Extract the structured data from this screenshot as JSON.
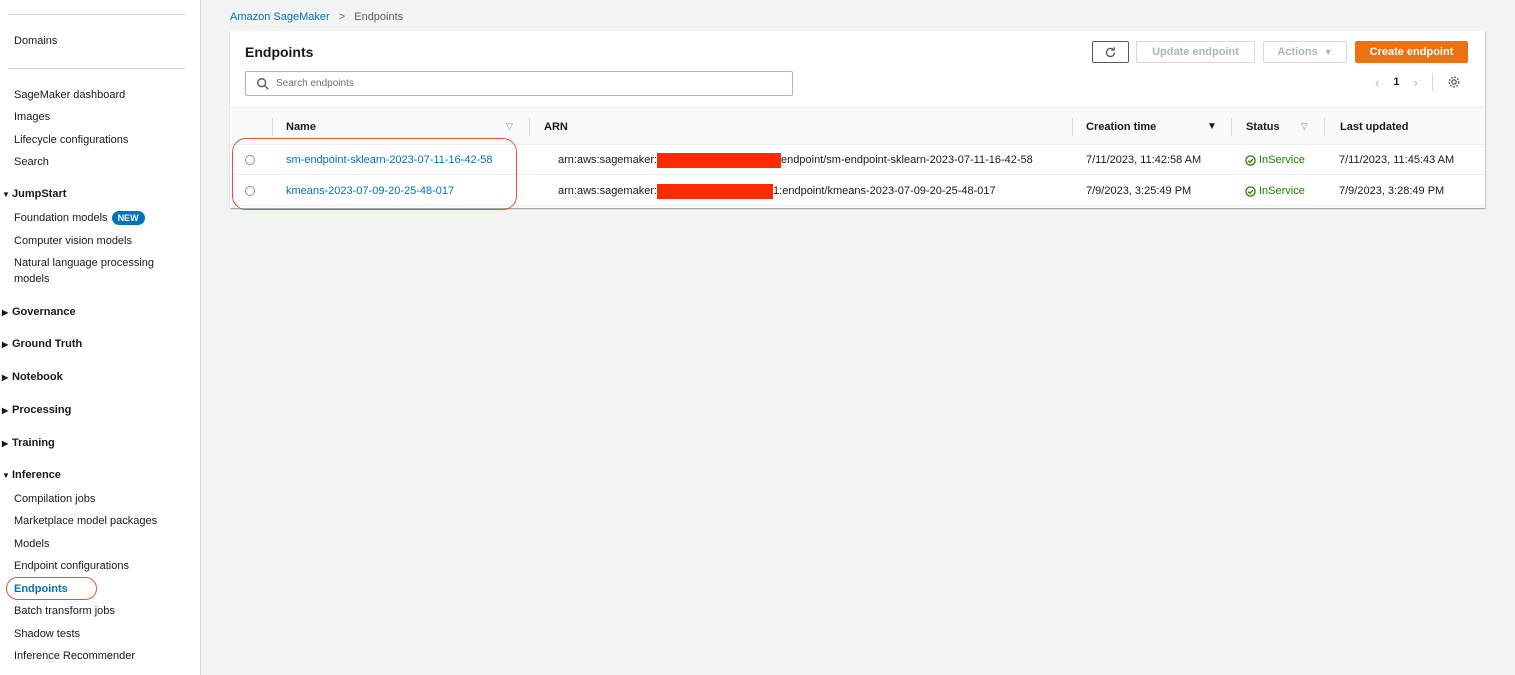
{
  "sidebar": {
    "top_items": [
      "Domains"
    ],
    "dashboard_items": [
      "SageMaker dashboard",
      "Images",
      "Lifecycle configurations",
      "Search"
    ],
    "jumpstart": {
      "title": "JumpStart",
      "items": [
        "Foundation models",
        "Computer vision models",
        "Natural language processing models"
      ],
      "new_badge": "NEW"
    },
    "collapsed_sections": [
      "Governance",
      "Ground Truth",
      "Notebook",
      "Processing",
      "Training"
    ],
    "inference": {
      "title": "Inference",
      "items": [
        "Compilation jobs",
        "Marketplace model packages",
        "Models",
        "Endpoint configurations",
        "Endpoints",
        "Batch transform jobs",
        "Shadow tests",
        "Inference Recommender"
      ],
      "active_item": "Endpoints"
    }
  },
  "breadcrumb": {
    "parent": "Amazon SageMaker",
    "current": "Endpoints"
  },
  "panel": {
    "title": "Endpoints",
    "buttons": {
      "update": "Update endpoint",
      "actions": "Actions",
      "create": "Create endpoint"
    },
    "search_placeholder": "Search endpoints",
    "page": "1"
  },
  "table": {
    "columns": [
      "Name",
      "ARN",
      "Creation time",
      "Status",
      "Last updated"
    ],
    "rows": [
      {
        "name": "sm-endpoint-sklearn-2023-07-11-16-42-58",
        "arn_prefix": "arn:aws:sagemaker:",
        "arn_suffix": "endpoint/sm-endpoint-sklearn-2023-07-11-16-42-58",
        "creation_time": "7/11/2023, 11:42:58 AM",
        "status": "InService",
        "last_updated": "7/11/2023, 11:45:43 AM"
      },
      {
        "name": "kmeans-2023-07-09-20-25-48-017",
        "arn_prefix": "arn:aws:sagemaker:",
        "arn_suffix": "1:endpoint/kmeans-2023-07-09-20-25-48-017",
        "creation_time": "7/9/2023, 3:25:49 PM",
        "status": "InService",
        "last_updated": "7/9/2023, 3:28:49 PM"
      }
    ]
  },
  "colors": {
    "link": "#0073bb",
    "primary_button": "#ec7211",
    "status_ok": "#1d8102",
    "redaction": "#ff2a00",
    "annotation_oval": "#e0553c"
  }
}
